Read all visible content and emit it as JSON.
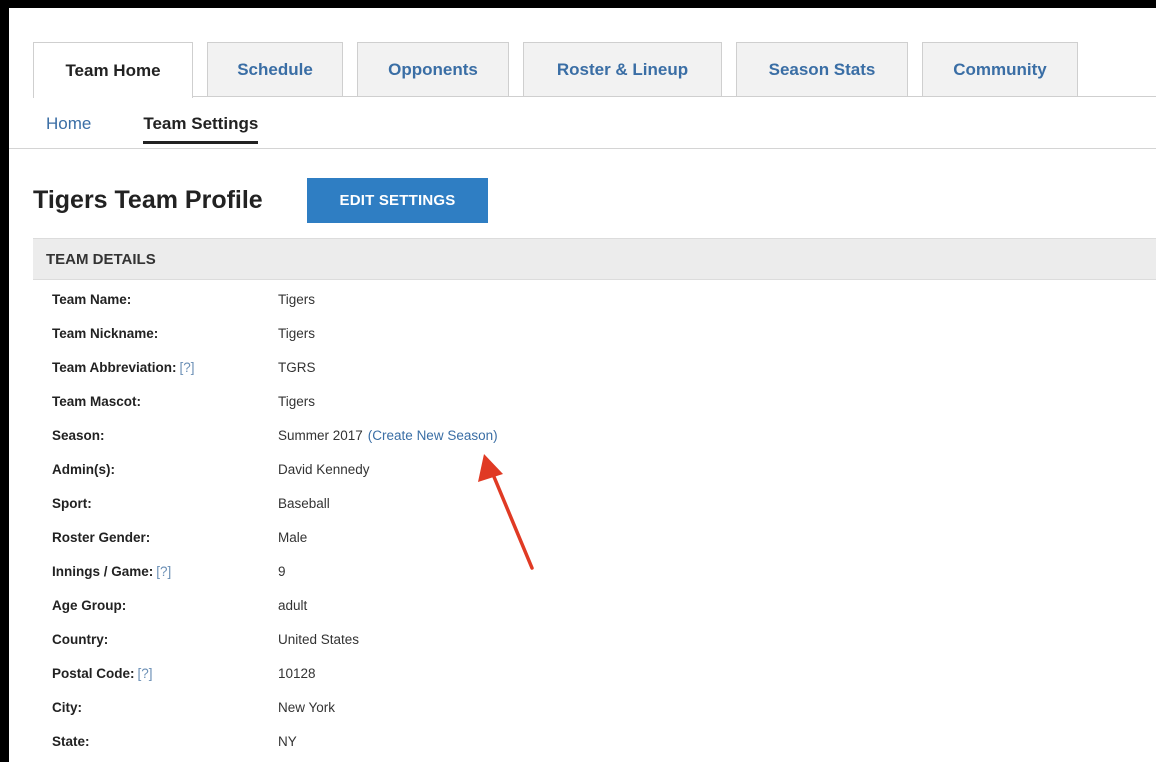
{
  "tabs": [
    {
      "label": "Team Home",
      "active": true
    },
    {
      "label": "Schedule"
    },
    {
      "label": "Opponents"
    },
    {
      "label": "Roster & Lineup"
    },
    {
      "label": "Season Stats"
    },
    {
      "label": "Community"
    }
  ],
  "subnav": [
    {
      "label": "Home"
    },
    {
      "label": "Team Settings",
      "active": true
    }
  ],
  "profile": {
    "title": "Tigers Team Profile",
    "edit_button": "EDIT SETTINGS"
  },
  "section": {
    "title": "TEAM DETAILS",
    "help_marker": "[?]",
    "rows": [
      {
        "label": "Team Name:",
        "value": "Tigers"
      },
      {
        "label": "Team Nickname:",
        "value": "Tigers"
      },
      {
        "label": "Team Abbreviation:",
        "value": "TGRS"
      },
      {
        "label": "Team Mascot:",
        "value": "Tigers"
      },
      {
        "label": "Season:",
        "value": "Summer 2017",
        "link": "(Create New Season)"
      },
      {
        "label": "Admin(s):",
        "value": "David Kennedy"
      },
      {
        "label": "Sport:",
        "value": "Baseball"
      },
      {
        "label": "Roster Gender:",
        "value": "Male"
      },
      {
        "label": "Innings / Game:",
        "value": "9"
      },
      {
        "label": "Age Group:",
        "value": "adult"
      },
      {
        "label": "Country:",
        "value": "United States"
      },
      {
        "label": "Postal Code:",
        "value": "10128"
      },
      {
        "label": "City:",
        "value": "New York"
      },
      {
        "label": "State:",
        "value": "NY"
      }
    ]
  },
  "annotation": {
    "arrow_color": "#e03a24"
  },
  "colors": {
    "link": "#3a6ea5",
    "button": "#2f7ec3",
    "section_bg": "#ececec"
  }
}
